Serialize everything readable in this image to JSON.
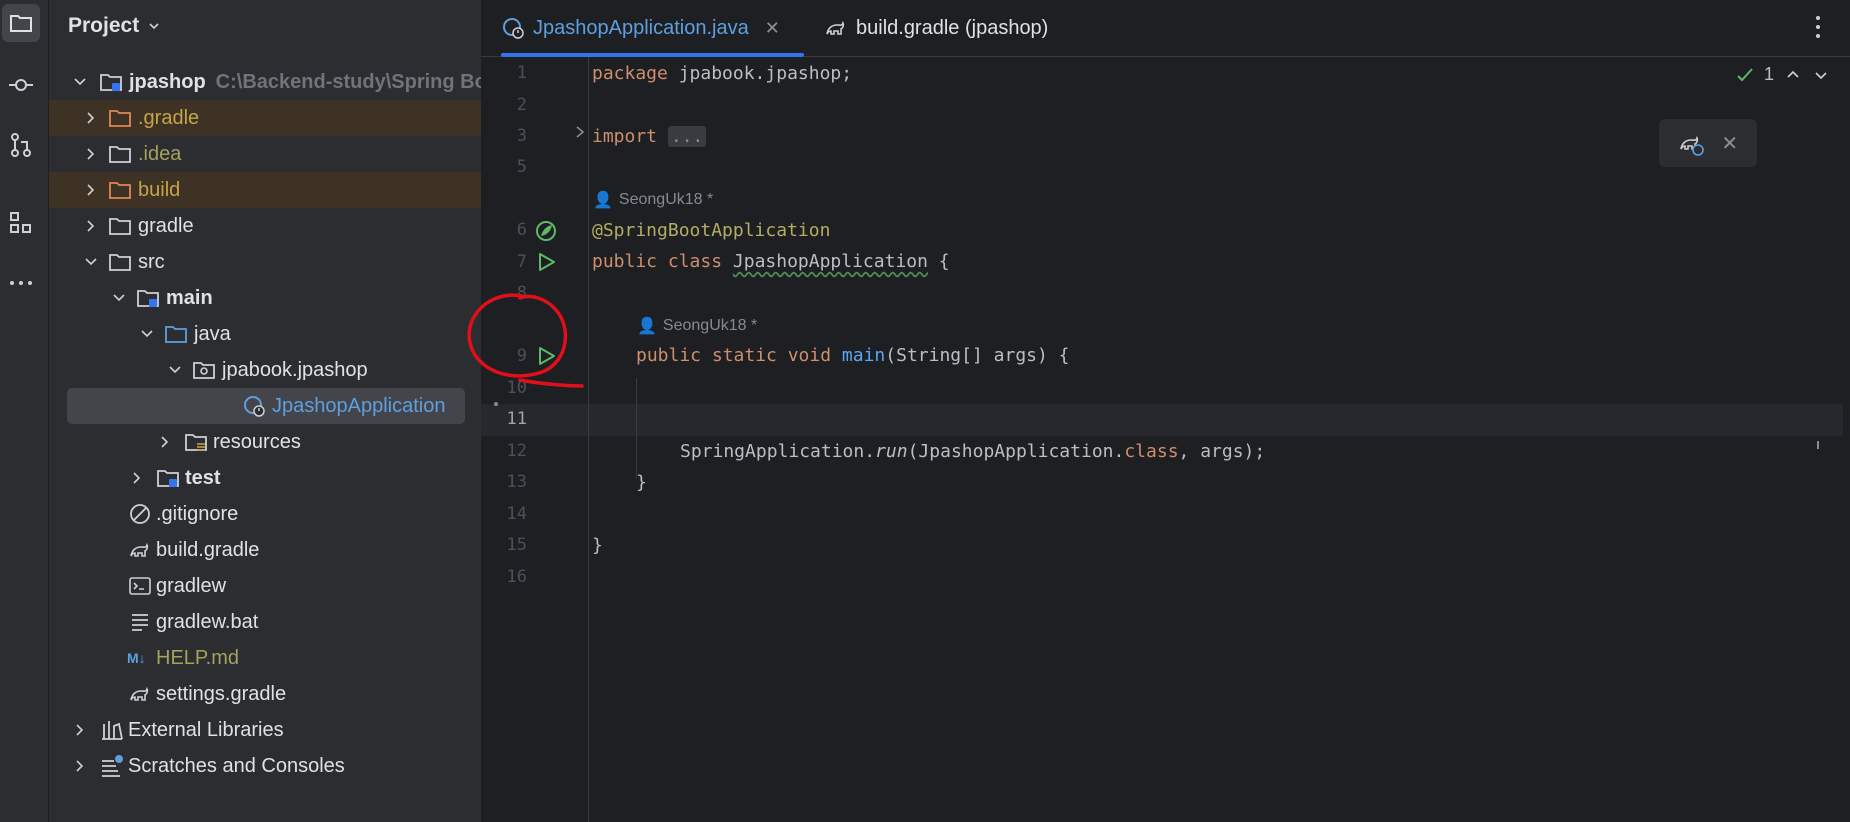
{
  "toolstrip": {
    "items": [
      {
        "name": "project-icon",
        "active": true
      },
      {
        "name": "commit-icon"
      },
      {
        "name": "pull-requests-icon"
      },
      {
        "name": "structure-icon"
      },
      {
        "name": "more-icon"
      }
    ]
  },
  "project": {
    "title": "Project",
    "tree": [
      {
        "label": "jpashop",
        "hint": "C:\\Backend-study\\Spring Bo",
        "icon": "module-folder-icon"
      },
      {
        "label": ".gradle",
        "icon": "folder-icon"
      },
      {
        "label": ".idea",
        "icon": "folder-icon"
      },
      {
        "label": "build",
        "icon": "folder-icon"
      },
      {
        "label": "gradle",
        "icon": "folder-icon"
      },
      {
        "label": "src",
        "icon": "folder-icon"
      },
      {
        "label": "main",
        "icon": "source-folder-icon"
      },
      {
        "label": "java",
        "icon": "source-root-icon"
      },
      {
        "label": "jpabook.jpashop",
        "icon": "package-icon"
      },
      {
        "label": "JpashopApplication",
        "icon": "spring-class-icon"
      },
      {
        "label": "resources",
        "icon": "resources-folder-icon"
      },
      {
        "label": "test",
        "icon": "source-folder-icon"
      },
      {
        "label": ".gitignore",
        "icon": "ignore-file-icon"
      },
      {
        "label": "build.gradle",
        "icon": "gradle-icon"
      },
      {
        "label": "gradlew",
        "icon": "terminal-file-icon"
      },
      {
        "label": "gradlew.bat",
        "icon": "text-file-icon"
      },
      {
        "label": "HELP.md",
        "icon": "markdown-icon",
        "badge": "M↓"
      },
      {
        "label": "settings.gradle",
        "icon": "gradle-icon"
      },
      {
        "label": "External Libraries",
        "icon": "libraries-icon"
      },
      {
        "label": "Scratches and Consoles",
        "icon": "scratches-icon"
      }
    ]
  },
  "editor": {
    "tabs": [
      {
        "label": "JpashopApplication.java",
        "close": "✕"
      },
      {
        "label": "build.gradle (jpashop)"
      }
    ],
    "inspections": {
      "count": "1"
    },
    "line_numbers": [
      "1",
      "2",
      "3",
      "5",
      "6",
      "7",
      "8",
      "9",
      "10",
      "11",
      "12",
      "13",
      "14",
      "15",
      "16"
    ],
    "code": {
      "l1_kw": "package",
      "l1_rest": " jpabook.jpashop;",
      "l3_kw": "import",
      "l3_fold": "...",
      "author1": "SeongUk18 *",
      "l6_ann": "@SpringBootApplication",
      "l7_kw": "public class",
      "l7_name": "JpashopApplication",
      "l7_rest": " {",
      "author2": "SeongUk18 *",
      "l9_kw": "public static void",
      "l9_fn": "main",
      "l9_rest": "(String[] args) {",
      "l12_a": "SpringApplication.",
      "l12_run": "run",
      "l12_b": "(JpashopApplication.",
      "l12_kw": "class",
      "l12_c": ", args);",
      "l13": "}",
      "l15": "}"
    },
    "popup": {
      "close": "✕"
    }
  },
  "colors": {
    "accent": "#3574f0",
    "annotation_circle": "#e0101a",
    "run_green": "#5fb865"
  }
}
